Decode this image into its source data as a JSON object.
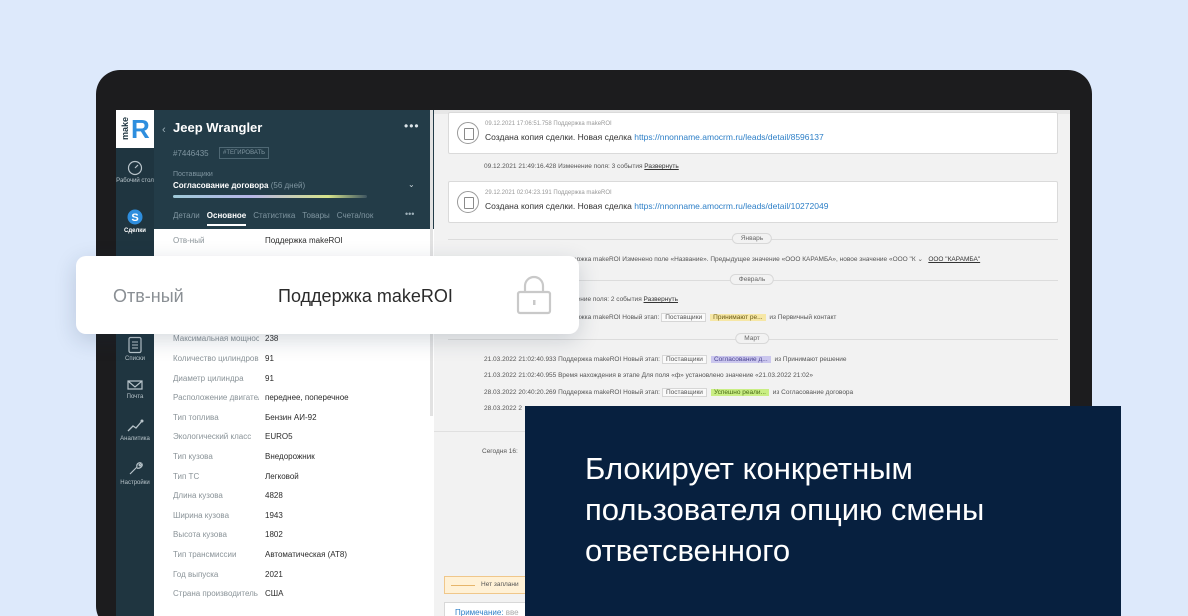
{
  "sidebar": {
    "logo_text": "make",
    "logo_letter": "R",
    "items": [
      {
        "label": "Рабочий стол",
        "icon": "dashboard-icon"
      },
      {
        "label": "Сделки",
        "icon": "deals-icon",
        "active": true
      },
      {
        "label": "Списки",
        "icon": "lists-icon"
      },
      {
        "label": "Почта",
        "icon": "mail-icon"
      },
      {
        "label": "Аналитика",
        "icon": "analytics-icon"
      },
      {
        "label": "Настройки",
        "icon": "settings-icon"
      }
    ]
  },
  "lead": {
    "title": "Jeep Wrangler",
    "id": "#7446435",
    "tag_button": "#ТЕГИРОВАТЬ",
    "pipeline": "Поставщики",
    "stage": "Согласование договора",
    "stage_days": "(56 дней)",
    "tabs": [
      "Детали",
      "Основное",
      "Статистика",
      "Товары",
      "Счета/пок"
    ],
    "active_tab": "Основное",
    "fields": [
      {
        "label": "Отв-ный",
        "value": "Поддержка makeROI"
      },
      {
        "label": "Максимальная мощность",
        "value": "238"
      },
      {
        "label": "Количество цилиндров",
        "value": "91"
      },
      {
        "label": "Диаметр цилиндра",
        "value": "91"
      },
      {
        "label": "Расположение двигателя",
        "value": "переднее, поперечное"
      },
      {
        "label": "Тип топлива",
        "value": "Бензин АИ-92"
      },
      {
        "label": "Экологический класс",
        "value": "EURO5"
      },
      {
        "label": "Тип кузова",
        "value": "Внедорожник"
      },
      {
        "label": "Тип ТС",
        "value": "Легковой"
      },
      {
        "label": "Длина кузова",
        "value": "4828"
      },
      {
        "label": "Ширина кузова",
        "value": "1943"
      },
      {
        "label": "Высота кузова",
        "value": "1802"
      },
      {
        "label": "Тип трансмиссии",
        "value": "Автоматическая (AT8)"
      },
      {
        "label": "Год выпуска",
        "value": "2021"
      },
      {
        "label": "Страна производитель",
        "value": "США"
      }
    ]
  },
  "feed": {
    "note1": {
      "meta": "09.12.2021 17:06:51.758 Поддержка makeROI",
      "text": "Создана копия сделки. Новая сделка",
      "link": "https://nnonname.amocrm.ru/leads/detail/8596137"
    },
    "event1": {
      "text": "09.12.2021 21:49:16.428 Изменение поля: 3 события",
      "action": "Развернуть"
    },
    "note2": {
      "meta": "29.12.2021 02:04:23.191 Поддержка makeROI",
      "text": "Создана копия сделки. Новая сделка",
      "link": "https://nnonname.amocrm.ru/leads/detail/10272049"
    },
    "months": [
      "Январь",
      "Февраль",
      "Март"
    ],
    "jan_event": {
      "text": "оддержка makeROI Изменено поле «Название». Предыдущее значение «ООО КАРАМБА», новое значение «ООО \"К",
      "tail": "ООО \"КАРАМБА\""
    },
    "feb_event1": {
      "text": "зменение поля: 2 события",
      "action": "Развернуть"
    },
    "feb_event2": {
      "prefix": "оддержка makeROI Новый этап:",
      "pipeline": "Поставщики",
      "stage": "Принимают ре...",
      "suffix": "из Первичный контакт"
    },
    "mar_event1": {
      "prefix": "21.03.2022 21:02:40.933 Поддержка makeROI Новый этап:",
      "pipeline": "Поставщики",
      "stage": "Согласование д...",
      "suffix": "из Принимают решение"
    },
    "mar_event2": {
      "text": "21.03.2022 21:02:40.955 Время нахождения в этапе Для поля «ф» установлено значение «21.03.2022 21:02»"
    },
    "mar_event3": {
      "prefix": "28.03.2022 20:40:20.269 Поддержка makeROI Новый этап:",
      "pipeline": "Поставщики",
      "stage": "Успешно реали...",
      "suffix": "из Согласование договора"
    },
    "mar_event4": {
      "text": "28.03.2022 2"
    },
    "today": {
      "text": "Сегодня 16:"
    },
    "no_tasks": "Нет заплани",
    "note_input": {
      "label": "Примечание:",
      "placeholder": "вве"
    }
  },
  "floating_field": {
    "label": "Отв-ный",
    "value": "Поддержка makeROI",
    "icon": "lock-icon"
  },
  "banner": {
    "message": "Блокирует конкретным пользователя опцию смены ответсвенного"
  },
  "colors": {
    "background": "#dde9fb",
    "sidebar": "#1f3540",
    "card_header": "#233c48",
    "banner": "#07203f",
    "link": "#2d7fc7",
    "logo_accent": "#2e8ede"
  }
}
